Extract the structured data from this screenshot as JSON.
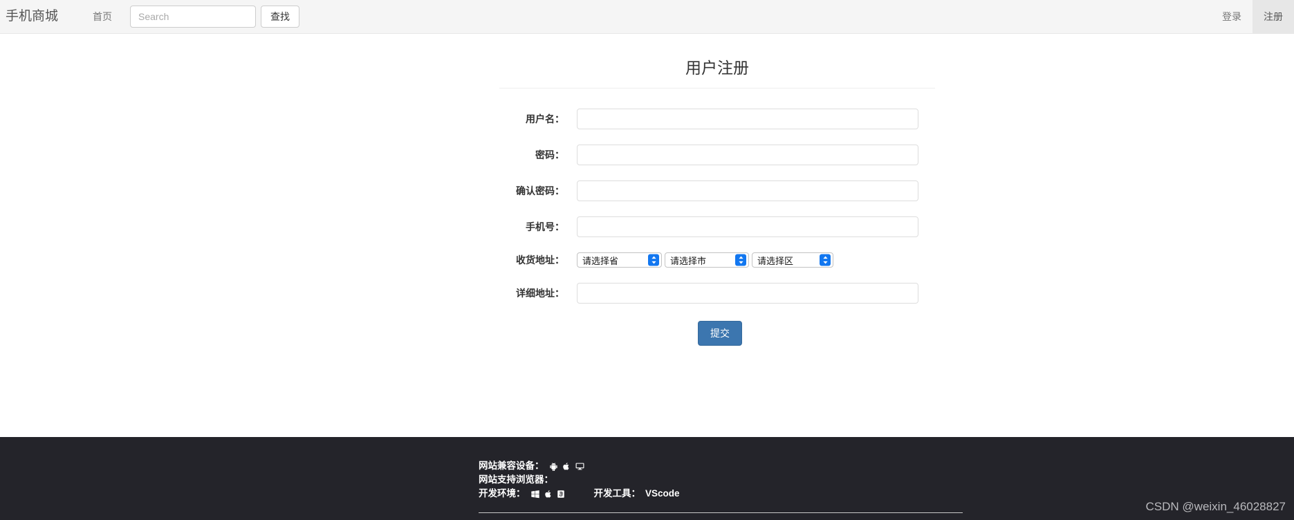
{
  "navbar": {
    "brand": "手机商城",
    "home_label": "首页",
    "search": {
      "placeholder": "Search",
      "value": "",
      "button_label": "查找"
    },
    "login_label": "登录",
    "register_label": "注册",
    "active_item": "注册",
    "background_color": "#f5f5f5",
    "active_background_color": "#e7e7e7"
  },
  "form": {
    "title": "用户注册",
    "fields": [
      {
        "label": "用户名：",
        "value": "",
        "placeholder": "",
        "type": "text"
      },
      {
        "label": "密码：",
        "value": "",
        "placeholder": "",
        "type": "password"
      },
      {
        "label": "确认密码：",
        "value": "",
        "placeholder": "",
        "type": "password"
      },
      {
        "label": "手机号：",
        "value": "",
        "placeholder": "",
        "type": "text"
      }
    ],
    "address": {
      "label": "收货地址：",
      "selects": [
        {
          "name": "province",
          "selected": "请选择省"
        },
        {
          "name": "city",
          "selected": "请选择市"
        },
        {
          "name": "district",
          "selected": "请选择区"
        }
      ]
    },
    "detail_address": {
      "label": "详细地址：",
      "value": "",
      "placeholder": ""
    },
    "submit_label": "提交",
    "submit_color": "#3c76af"
  },
  "footer": {
    "background_color": "#24242a",
    "devices": {
      "label": "网站兼容设备：",
      "icons": [
        "android-icon",
        "apple-icon",
        "desktop-icon"
      ]
    },
    "browsers": {
      "label": "网站支持浏览器：",
      "icons": []
    },
    "dev_env": {
      "label": "开发环境：",
      "icons": [
        "windows-icon",
        "apple-icon",
        "html5-icon"
      ]
    },
    "dev_tool": {
      "label": "开发工具：",
      "value": "VScode"
    }
  },
  "watermark": "CSDN @weixin_46028827"
}
